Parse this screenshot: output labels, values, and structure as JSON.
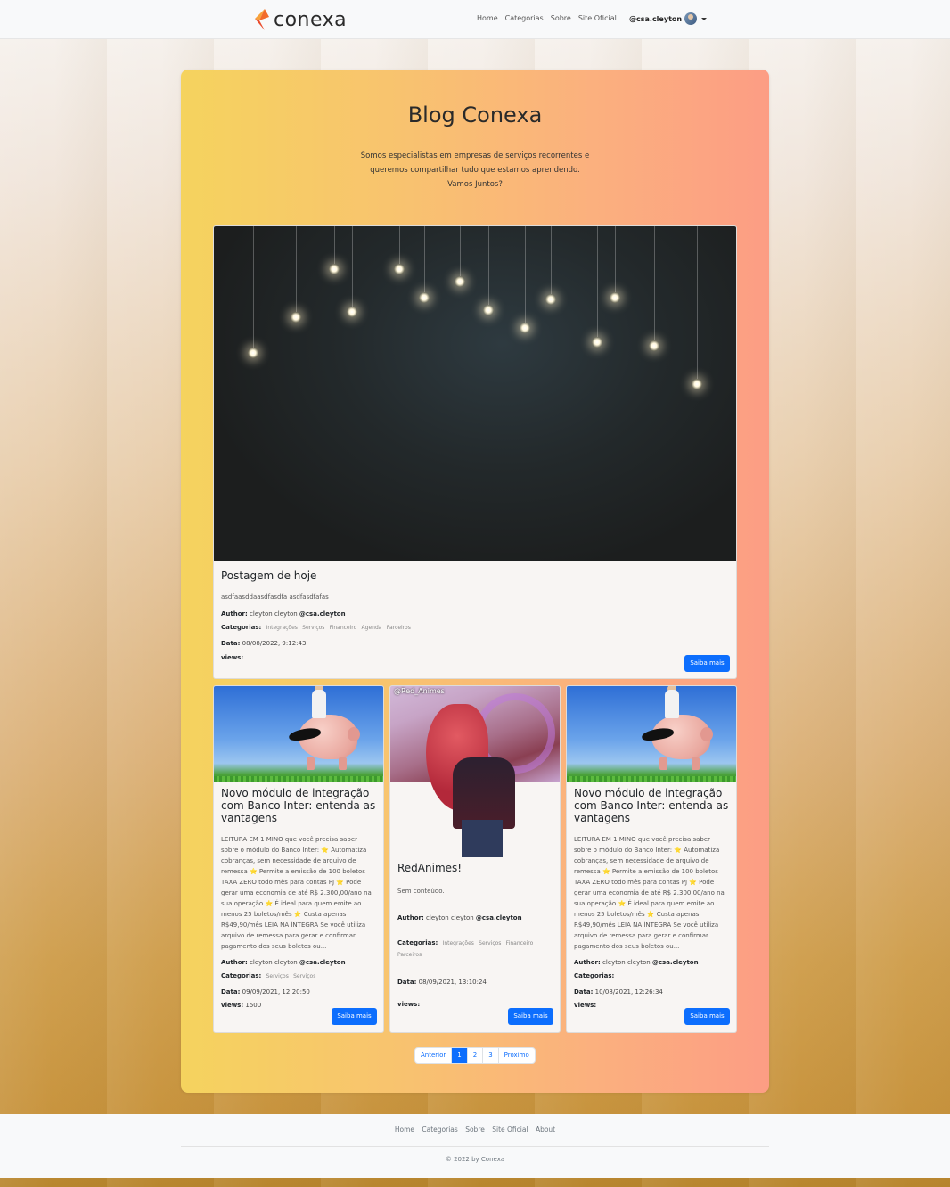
{
  "navbar": {
    "brand": "conexa",
    "links": [
      "Home",
      "Categorias",
      "Sobre",
      "Site Oficial"
    ],
    "user": "@csa.cleyton"
  },
  "hero": {
    "title": "Blog Conexa",
    "description_lines": [
      "Somos especialistas em empresas de serviços recorrentes e",
      "queremos compartilhar tudo que estamos aprendendo.",
      "Vamos Juntos?"
    ]
  },
  "labels": {
    "author": "Author:",
    "categories": "Categorias:",
    "date": "Data:",
    "views": "views:",
    "button": "Saiba mais"
  },
  "featured": {
    "title": "Postagem de hoje",
    "excerpt": "asdfaasddaasdfasdfa asdfasdfafas",
    "author_name": "cleyton cleyton",
    "author_handle": "@csa.cleyton",
    "categories": [
      "Integrações",
      "Serviços",
      "Financeiro",
      "Agenda",
      "Parceiros"
    ],
    "date": "08/08/2022, 9:12:43",
    "views": ""
  },
  "posts": [
    {
      "title": "Novo módulo de integração com Banco Inter: entenda as vantagens",
      "excerpt": "LEITURA EM 1 MINO que você precisa saber sobre o módulo do Banco Inter: ⭐ Automatiza cobranças, sem necessidade de arquivo de remessa ⭐ Permite a emissão de 100 boletos TAXA ZERO todo mês para contas PJ ⭐ Pode gerar uma economia de até R$ 2.300,00/ano na sua operação ⭐ É ideal para quem emite ao menos 25 boletos/mês ⭐ Custa apenas R$49,90/mês LEIA NA ÍNTEGRA Se você utiliza arquivo de remessa para gerar e confirmar pagamento dos seus boletos ou...",
      "author_name": "cleyton cleyton",
      "author_handle": "@csa.cleyton",
      "categories": [
        "Serviços",
        "Serviços"
      ],
      "date": "09/09/2021, 12:20:50",
      "views": "1500"
    },
    {
      "title": "RedAnimes!",
      "excerpt": "Sem conteúdo.",
      "image_tag": "@Red_Animes",
      "author_name": "cleyton cleyton",
      "author_handle": "@csa.cleyton",
      "categories": [
        "Integrações",
        "Serviços",
        "Financeiro",
        "Parceiros"
      ],
      "date": "08/09/2021, 13:10:24",
      "views": ""
    },
    {
      "title": "Novo módulo de integração com Banco Inter: entenda as vantagens",
      "excerpt": "LEITURA EM 1 MINO que você precisa saber sobre o módulo do Banco Inter: ⭐ Automatiza cobranças, sem necessidade de arquivo de remessa ⭐ Permite a emissão de 100 boletos TAXA ZERO todo mês para contas PJ ⭐ Pode gerar uma economia de até R$ 2.300,00/ano na sua operação ⭐ É ideal para quem emite ao menos 25 boletos/mês ⭐ Custa apenas R$49,90/mês LEIA NA ÍNTEGRA Se você utiliza arquivo de remessa para gerar e confirmar pagamento dos seus boletos ou...",
      "author_name": "cleyton cleyton",
      "author_handle": "@csa.cleyton",
      "categories": [],
      "date": "10/08/2021, 12:26:34",
      "views": ""
    }
  ],
  "pagination": {
    "prev": "Anterior",
    "pages": [
      "1",
      "2",
      "3"
    ],
    "active": "1",
    "next": "Próximo"
  },
  "footer": {
    "links": [
      "Home",
      "Categorias",
      "Sobre",
      "Site Oficial",
      "About"
    ],
    "copyright": "© 2022 by Conexa"
  },
  "colors": {
    "primary": "#0d6efd",
    "brand_orange": "#f26b2a",
    "hero_gradient_start": "#f5d35e",
    "hero_gradient_end": "#fc9d84"
  }
}
